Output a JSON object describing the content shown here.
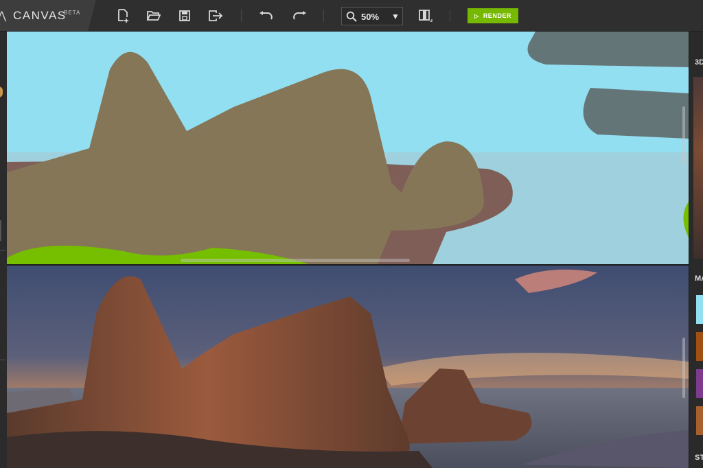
{
  "app": {
    "name": "CANVAS",
    "badge": "BETA"
  },
  "toolbar": {
    "buttons": [
      "new-file-icon",
      "open-folder-icon",
      "save-icon",
      "export-icon",
      "undo-icon",
      "redo-icon",
      "compare-icon"
    ],
    "zoom": {
      "value": "50%",
      "icon": "magnifier-icon"
    },
    "render_label": "RENDER",
    "render_color": "#76b900"
  },
  "canvas": {
    "materials_painted": {
      "sky": "#93dff2",
      "water": "#9fd0dd",
      "mountain": "#857657",
      "rock": "#7f5e58",
      "cloud": "#647578",
      "grass": "#76be00"
    }
  },
  "right_panel": {
    "section_1": "3D",
    "section_2": "MA",
    "section_3": "ST",
    "swatches": [
      "#93dff2",
      "#a24f12",
      "#7e3b8e",
      "#a8602e"
    ]
  }
}
